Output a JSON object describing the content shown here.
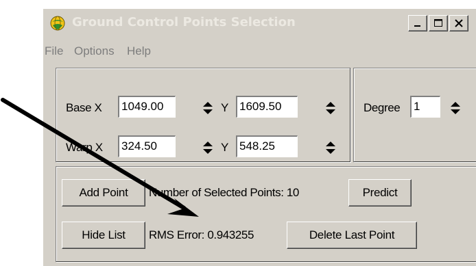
{
  "window": {
    "title": "Ground Control Points Selection",
    "title_color": "#ece9e2",
    "background": "#d4d0c8"
  },
  "titlebar_buttons": {
    "minimize_icon": "minimize-icon",
    "maximize_icon": "maximize-icon",
    "close_icon": "close-icon"
  },
  "menu": {
    "items": [
      "File",
      "Options",
      "Help"
    ],
    "text_color": "#7d7d7d"
  },
  "coords": {
    "base_x_label": "Base X",
    "base_x_value": "1049.00",
    "base_y_label": "Y",
    "base_y_value": "1609.50",
    "warp_x_label": "Warp X",
    "warp_x_value": "324.50",
    "warp_y_label": "Y",
    "warp_y_value": "548.25"
  },
  "degree": {
    "label": "Degree",
    "value": "1"
  },
  "actions": {
    "add_point_label": "Add Point",
    "selected_points_text": "Number of Selected Points: 10",
    "predict_label": "Predict",
    "hide_list_label": "Hide List",
    "rms_error_text": "RMS Error: 0.943255",
    "delete_last_point_label": "Delete Last Point"
  },
  "annotation": {
    "arrow_color": "#000000"
  }
}
